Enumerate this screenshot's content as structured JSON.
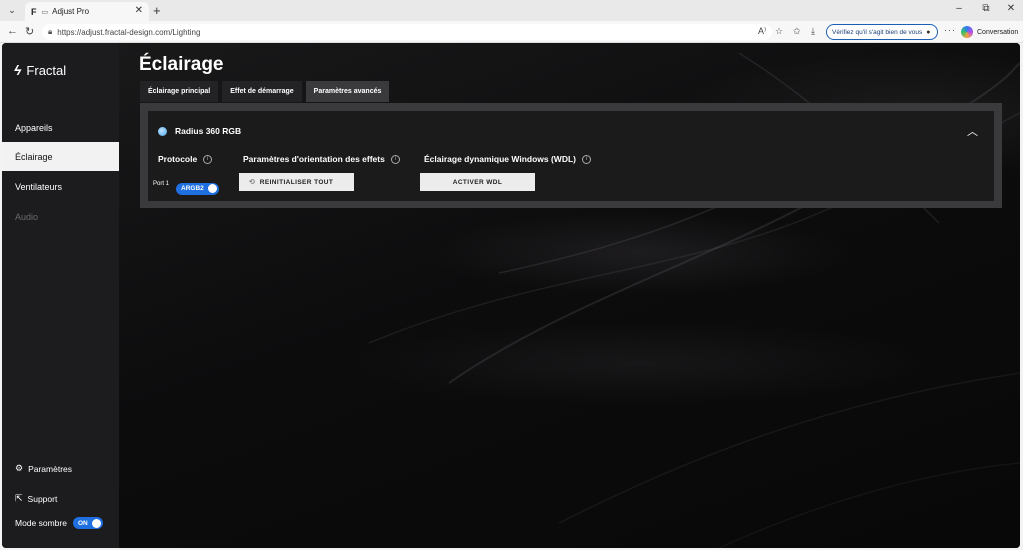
{
  "browser": {
    "tab_title": "Adjust Pro",
    "tab_favicon": "F",
    "tab_workspace": "▭",
    "new_tab": "+",
    "url": "https://adjust.fractal-design.com/Lighting",
    "verify_text": "Vérifiez qu'il s'agit bien de vous",
    "more_label": "···",
    "conversation_label": "Conversation",
    "controls": {
      "minimize": "–",
      "restore": "⧉",
      "close": "✕"
    }
  },
  "sidebar": {
    "brand": "Fractal",
    "items": [
      {
        "label": "Appareils",
        "state": "normal"
      },
      {
        "label": "Éclairage",
        "state": "active"
      },
      {
        "label": "Ventilateurs",
        "state": "normal"
      },
      {
        "label": "Audio",
        "state": "disabled"
      }
    ],
    "settings_label": "Paramètres",
    "support_label": "Support",
    "dark_mode_label": "Mode sombre",
    "dark_mode_value": "ON"
  },
  "main": {
    "title": "Éclairage",
    "tabs": [
      {
        "label": "Éclairage principal",
        "active": false
      },
      {
        "label": "Effet de démarrage",
        "active": false
      },
      {
        "label": "Paramètres avancés",
        "active": true
      }
    ],
    "device": {
      "name": "Radius 360 RGB",
      "protocol_title": "Protocole",
      "port_label": "Port 1",
      "port_value": "ARGB2",
      "orientation_title": "Paramètres d'orientation des effets",
      "reset_button": "REINITIALISER TOUT",
      "wdl_title": "Éclairage dynamique Windows (WDL)",
      "wdl_button": "ACTIVER WDL"
    }
  },
  "colors": {
    "accent": "#1f6fe0",
    "sidebar_bg": "#1c1c1e",
    "panel_bg": "#3a3a3d",
    "card_bg": "#1b1b1c"
  }
}
